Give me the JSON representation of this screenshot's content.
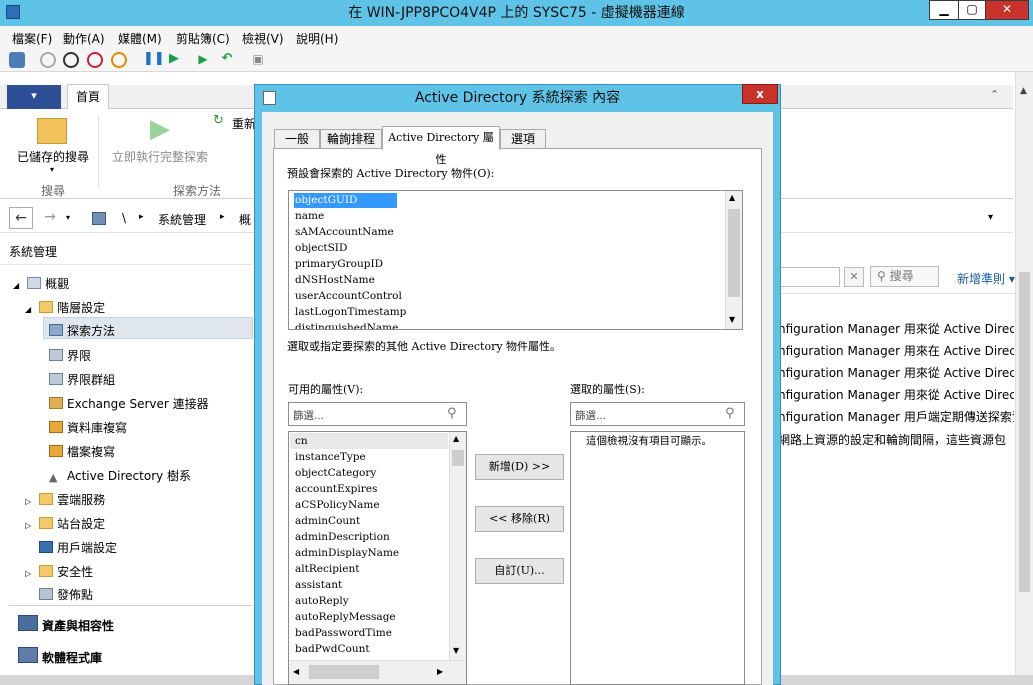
{
  "vm_window": {
    "title": "在 WIN-JPP8PCO4V4P 上的 SYSC75 - 虛擬機器連線",
    "minimize": "▁",
    "maximize": "▢",
    "close": "✕"
  },
  "menu": [
    "檔案(F)",
    "動作(A)",
    "媒體(M)",
    "剪貼簿(C)",
    "檢視(V)",
    "說明(H)"
  ],
  "ribbon": {
    "file_tab": "▾",
    "home_tab": "首頁",
    "saved_search": "已儲存的搜尋",
    "run_full": "立即執行完整探索",
    "refresh": "重新",
    "group_search": "搜尋",
    "group_discovery": "探索方法"
  },
  "address": {
    "sep1": "\\",
    "path": "系統管理",
    "more": "概"
  },
  "nav": {
    "header": "系統管理",
    "items": [
      "概觀",
      "階層設定",
      "探索方法",
      "界限",
      "界限群組",
      "Exchange Server 連接器",
      "資料庫複寫",
      "檔案複寫",
      "Active Directory 樹系",
      "雲端服務",
      "站台設定",
      "用戶端設定",
      "安全性",
      "發佈點"
    ],
    "workspaces": [
      "資產與相容性",
      "軟體程式庫"
    ]
  },
  "search": {
    "button": "搜尋",
    "add_criteria": "新增準則"
  },
  "list_rows": [
    "nfiguration Manager 用來從 Active Directo",
    "nfiguration Manager 用來在 Active Directo",
    "nfiguration Manager 用來從 Active Directo",
    "nfiguration Manager 用來從 Active Directo",
    "nfiguration Manager 用戶端定期傳送探索資",
    "網路上資源的設定和輪詢間隔，這些資源包"
  ],
  "dialog": {
    "title": "Active Directory 系統探索 內容",
    "close": "x",
    "tabs": [
      "一般",
      "輪詢排程",
      "Active Directory 屬性",
      "選項"
    ],
    "default_label": "預設會探索的 Active Directory 物件(O):",
    "default_objects": [
      "objectGUID",
      "name",
      "sAMAccountName",
      "objectSID",
      "primaryGroupID",
      "dNSHostName",
      "userAccountControl",
      "lastLogonTimestamp",
      "distinguishedName"
    ],
    "hint": "選取或指定要探索的其他 Active Directory 物件屬性。",
    "available_label": "可用的屬性(V):",
    "selected_label": "選取的屬性(S):",
    "filter_placeholder": "篩選...",
    "available": [
      "cn",
      "instanceType",
      "objectCategory",
      "accountExpires",
      "aCSPolicyName",
      "adminCount",
      "adminDescription",
      "adminDisplayName",
      "altRecipient",
      "assistant",
      "autoReply",
      "autoReplyMessage",
      "badPasswordTime",
      "badPwdCount"
    ],
    "empty_text": "這個檢視沒有項目可顯示。",
    "add_button": "新增(D) >>",
    "remove_button": "<< 移除(R)",
    "custom_button": "自訂(U)..."
  }
}
